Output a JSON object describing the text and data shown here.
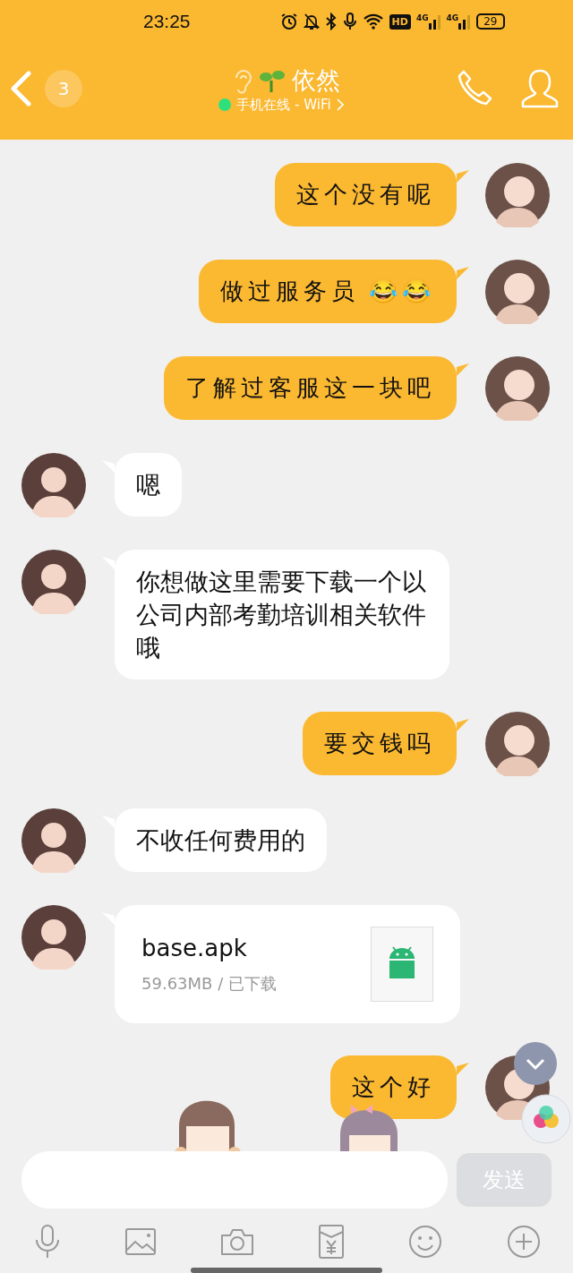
{
  "status_bar": {
    "time": "23:25",
    "hd_badge": "HD",
    "network": [
      "4G",
      "4G"
    ],
    "battery": "29"
  },
  "header": {
    "unread": "3",
    "name": "依然",
    "status": "手机在线 - WiFi",
    "online": true
  },
  "messages": [
    {
      "kind": "text",
      "outgoing": true,
      "text": "这个没有呢"
    },
    {
      "kind": "text",
      "outgoing": true,
      "text": "做过服务员 😂😂"
    },
    {
      "kind": "text",
      "outgoing": true,
      "text": "了解过客服这一块吧"
    },
    {
      "kind": "text",
      "outgoing": false,
      "text": "嗯"
    },
    {
      "kind": "text",
      "outgoing": false,
      "text": "你想做这里需要下载一个以公司内部考勤培训相关软件哦"
    },
    {
      "kind": "text",
      "outgoing": true,
      "text": "要交钱吗"
    },
    {
      "kind": "text",
      "outgoing": false,
      "text": "不收任何费用的"
    },
    {
      "kind": "file",
      "outgoing": false,
      "name": "base.apk",
      "info": "59.63MB / 已下载"
    },
    {
      "kind": "text",
      "outgoing": true,
      "text": "这个好"
    }
  ],
  "composer": {
    "send": "发送",
    "send_disabled": true
  }
}
